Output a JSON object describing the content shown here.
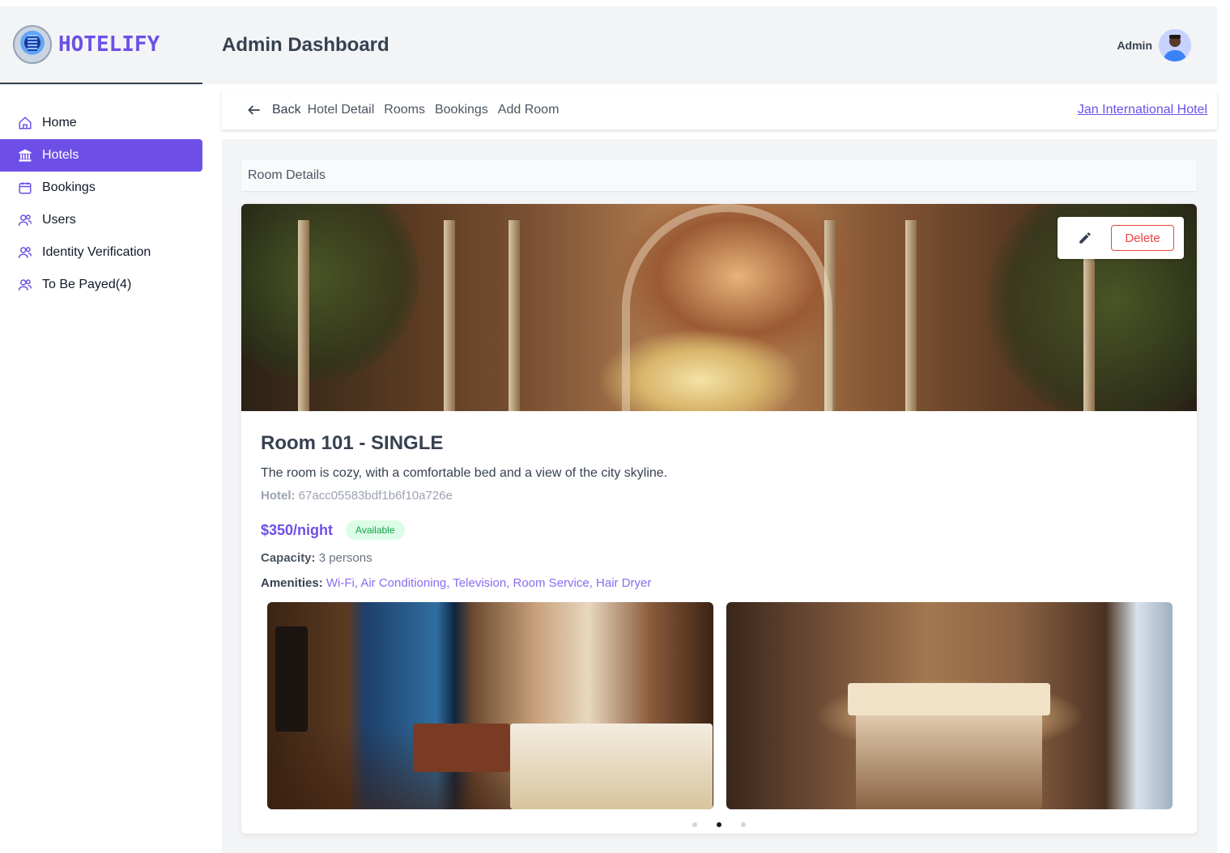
{
  "brand": {
    "name": "HOTELIFY",
    "logo_icon": "hotel-booking-logo"
  },
  "header": {
    "title": "Admin Dashboard",
    "user_name": "Admin"
  },
  "sidebar": {
    "items": [
      {
        "label": "Home",
        "icon": "home-icon",
        "active": false
      },
      {
        "label": "Hotels",
        "icon": "bank-icon",
        "active": true
      },
      {
        "label": "Bookings",
        "icon": "calendar-icon",
        "active": false
      },
      {
        "label": "Users",
        "icon": "users-icon",
        "active": false
      },
      {
        "label": "Identity Verification",
        "icon": "users-icon",
        "active": false
      },
      {
        "label": "To Be Payed(4)",
        "icon": "users-icon",
        "active": false
      }
    ]
  },
  "subnav": {
    "back_label": "Back",
    "links": [
      "Hotel Detail",
      "Rooms",
      "Bookings",
      "Add Room"
    ],
    "hotel_name": "Jan International Hotel"
  },
  "panel": {
    "title": "Room Details"
  },
  "room": {
    "title": "Room 101 - SINGLE",
    "description": "The room is cozy, with a comfortable bed and a view of the city skyline.",
    "hotel_label": "Hotel:",
    "hotel_id": "67acc05583bdf1b6f10a726e",
    "price": "$350/night",
    "status": "Available",
    "capacity_label": "Capacity:",
    "capacity_value": "3 persons",
    "amenities_label": "Amenities:",
    "amenities_value": "Wi-Fi, Air Conditioning, Television, Room Service, Hair Dryer"
  },
  "actions": {
    "delete_label": "Delete",
    "edit_icon": "pencil-icon"
  },
  "carousel": {
    "slide_count": 3,
    "active_index": 1
  },
  "colors": {
    "accent": "#6d4fe8",
    "danger": "#ef4444",
    "success_bg": "#dcfce7",
    "success_text": "#16a34a"
  }
}
